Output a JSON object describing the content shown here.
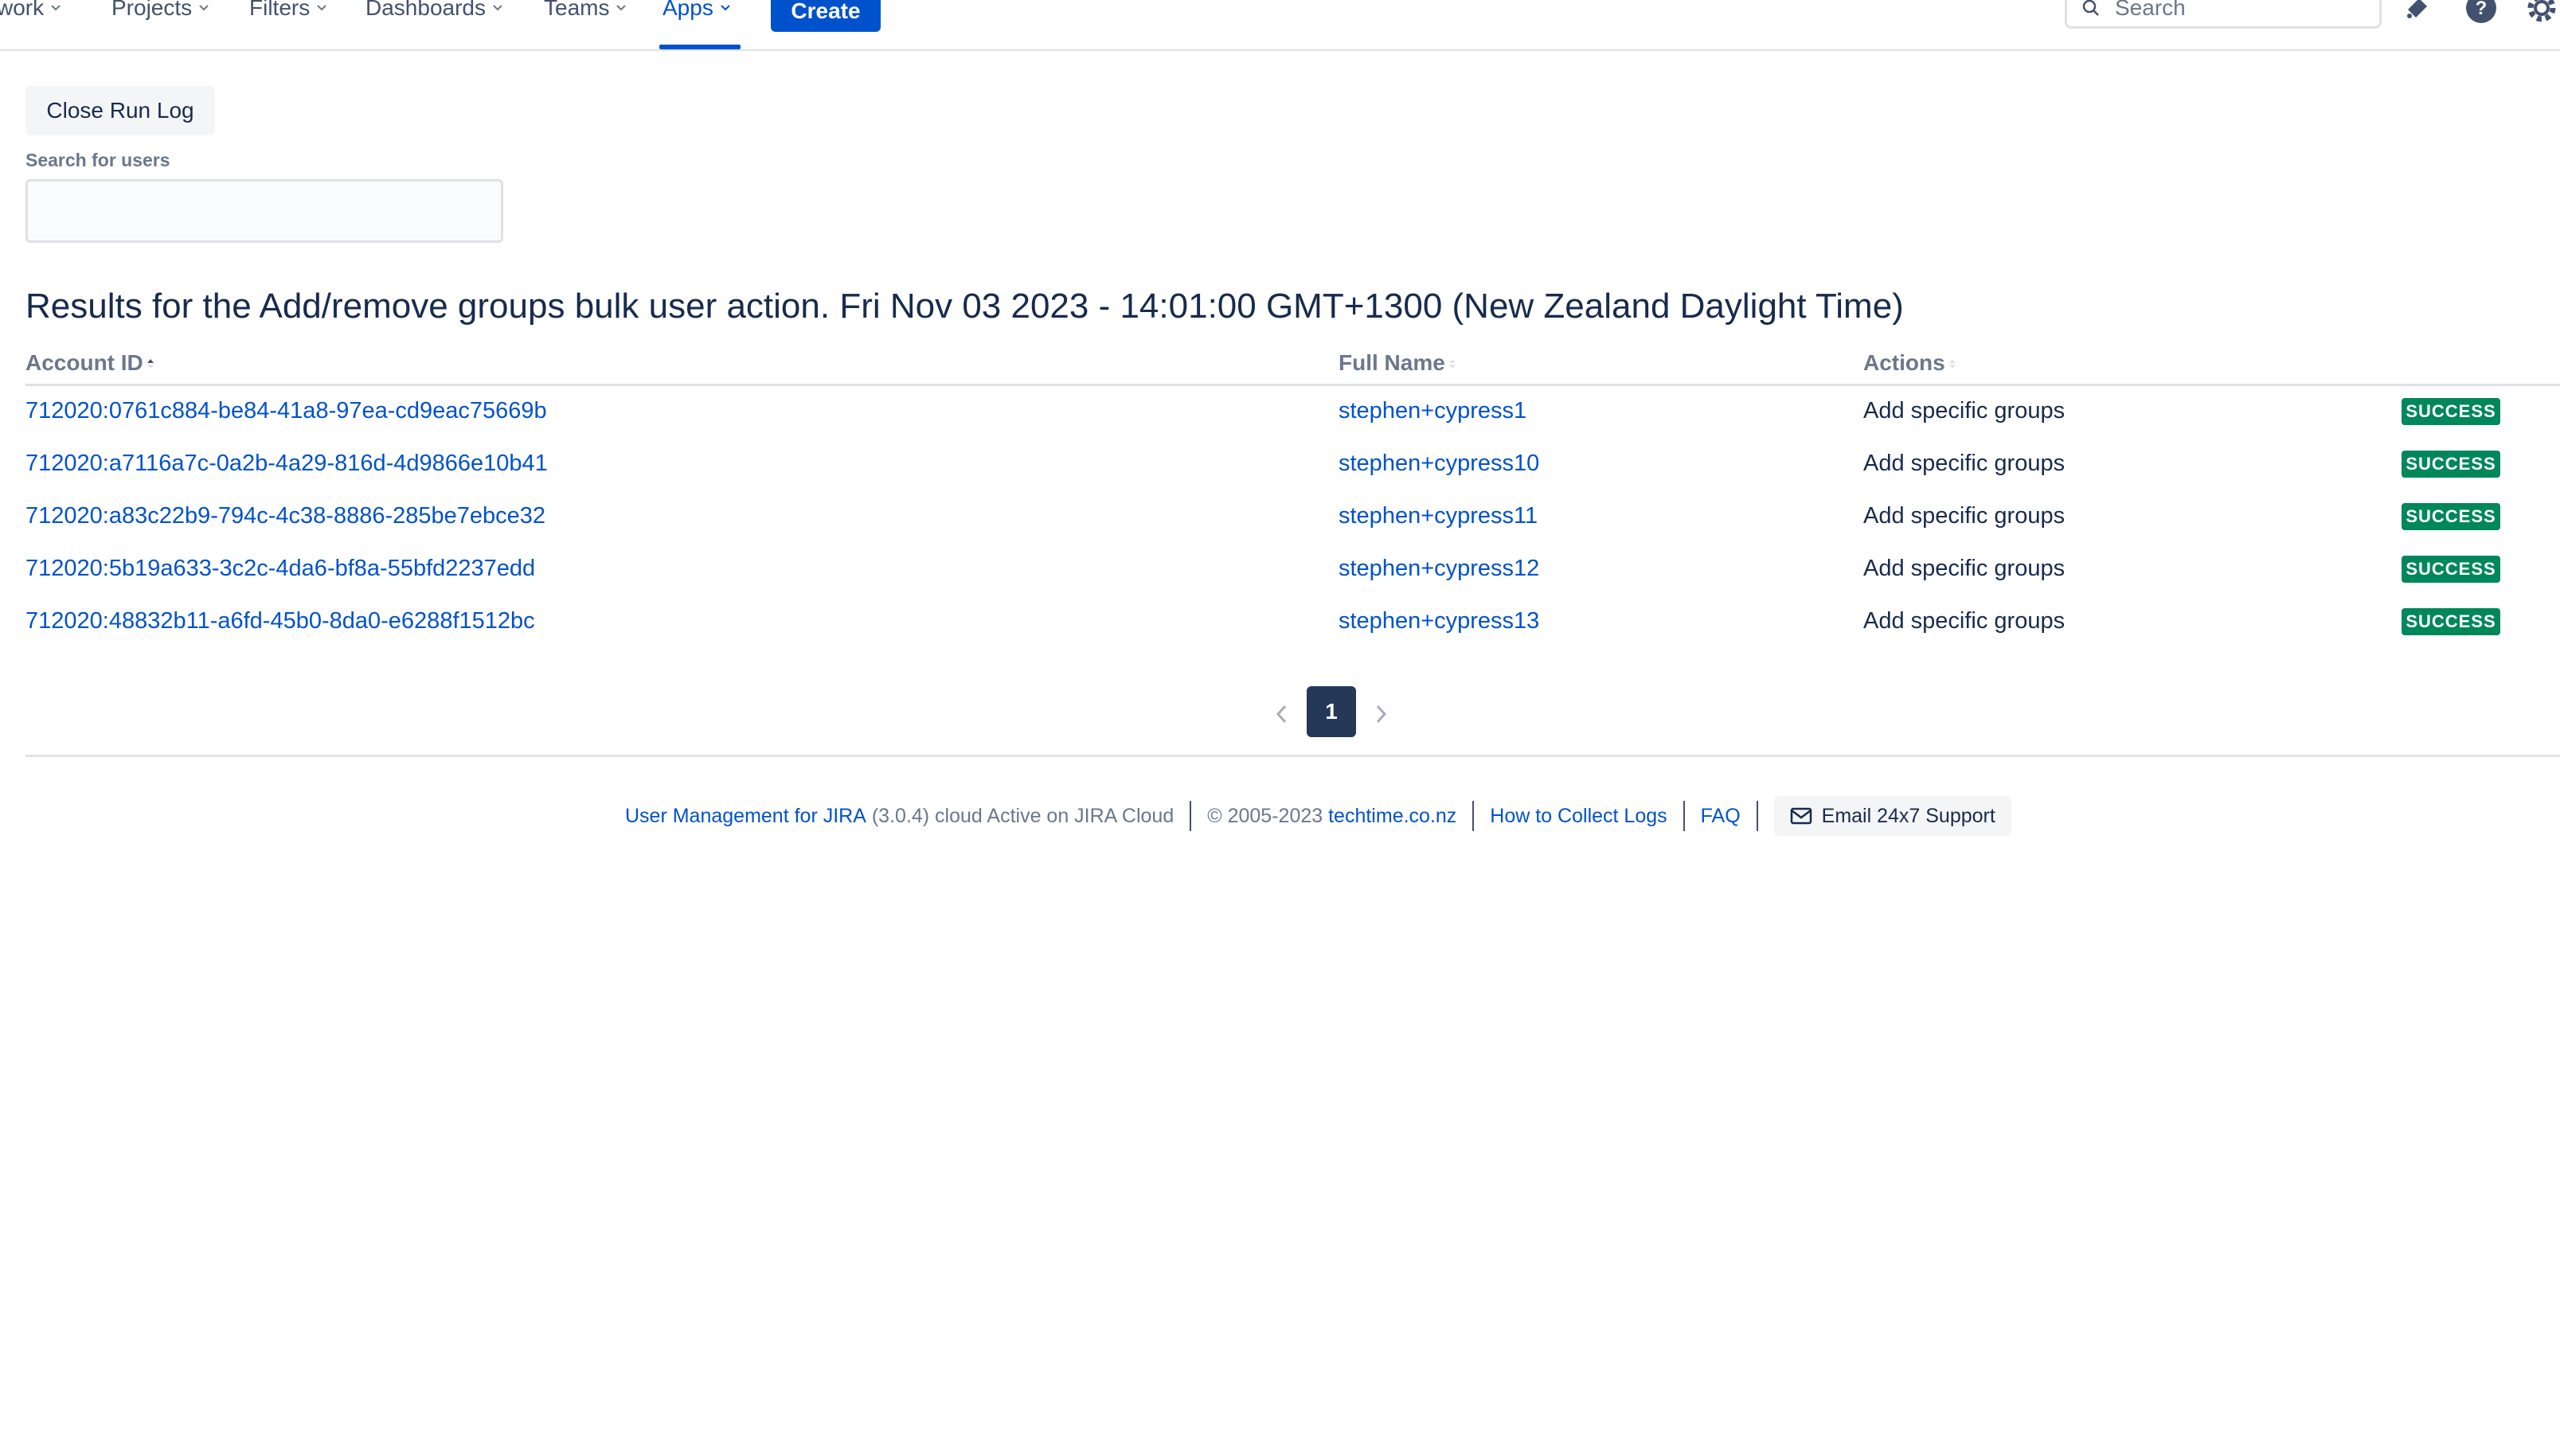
{
  "topnav": {
    "items": [
      {
        "label": "work"
      },
      {
        "label": "Projects"
      },
      {
        "label": "Filters"
      },
      {
        "label": "Dashboards"
      },
      {
        "label": "Teams"
      },
      {
        "label": "Apps"
      }
    ],
    "create_label": "Create",
    "search_placeholder": "Search"
  },
  "main": {
    "close_label": "Close Run Log",
    "search_label": "Search for users",
    "search_value": "",
    "title": "Results for the Add/remove groups bulk user action. Fri Nov 03 2023 - 14:01:00 GMT+1300 (New Zealand Daylight Time)"
  },
  "table": {
    "headers": [
      "Account ID",
      "Full Name",
      "Actions"
    ],
    "rows": [
      {
        "account_id": "712020:0761c884-be84-41a8-97ea-cd9eac75669b",
        "full_name": "stephen+cypress1",
        "action": "Add specific groups",
        "status": "SUCCESS"
      },
      {
        "account_id": "712020:a7116a7c-0a2b-4a29-816d-4d9866e10b41",
        "full_name": "stephen+cypress10",
        "action": "Add specific groups",
        "status": "SUCCESS"
      },
      {
        "account_id": "712020:a83c22b9-794c-4c38-8886-285be7ebce32",
        "full_name": "stephen+cypress11",
        "action": "Add specific groups",
        "status": "SUCCESS"
      },
      {
        "account_id": "712020:5b19a633-3c2c-4da6-bf8a-55bfd2237edd",
        "full_name": "stephen+cypress12",
        "action": "Add specific groups",
        "status": "SUCCESS"
      },
      {
        "account_id": "712020:48832b11-a6fd-45b0-8da0-e6288f1512bc",
        "full_name": "stephen+cypress13",
        "action": "Add specific groups",
        "status": "SUCCESS"
      }
    ]
  },
  "pagination": {
    "current": "1"
  },
  "footer": {
    "app_name": "User Management for JIRA",
    "version_text": "(3.0.4) cloud Active on JIRA Cloud",
    "copyright": "© 2005-2023",
    "company": "techtime.co.nz",
    "logs_link": "How to Collect Logs",
    "faq_link": "FAQ",
    "email_label": "Email 24x7 Support"
  },
  "colors": {
    "accent": "#0052cc",
    "success": "#00875a",
    "text": "#172b4d",
    "muted": "#6b778c"
  },
  "icons": [
    "chevron-down-icon",
    "search-icon",
    "notification-icon",
    "help-icon",
    "settings-icon",
    "sort-icon",
    "chevron-left-icon",
    "chevron-right-icon",
    "mail-icon"
  ]
}
